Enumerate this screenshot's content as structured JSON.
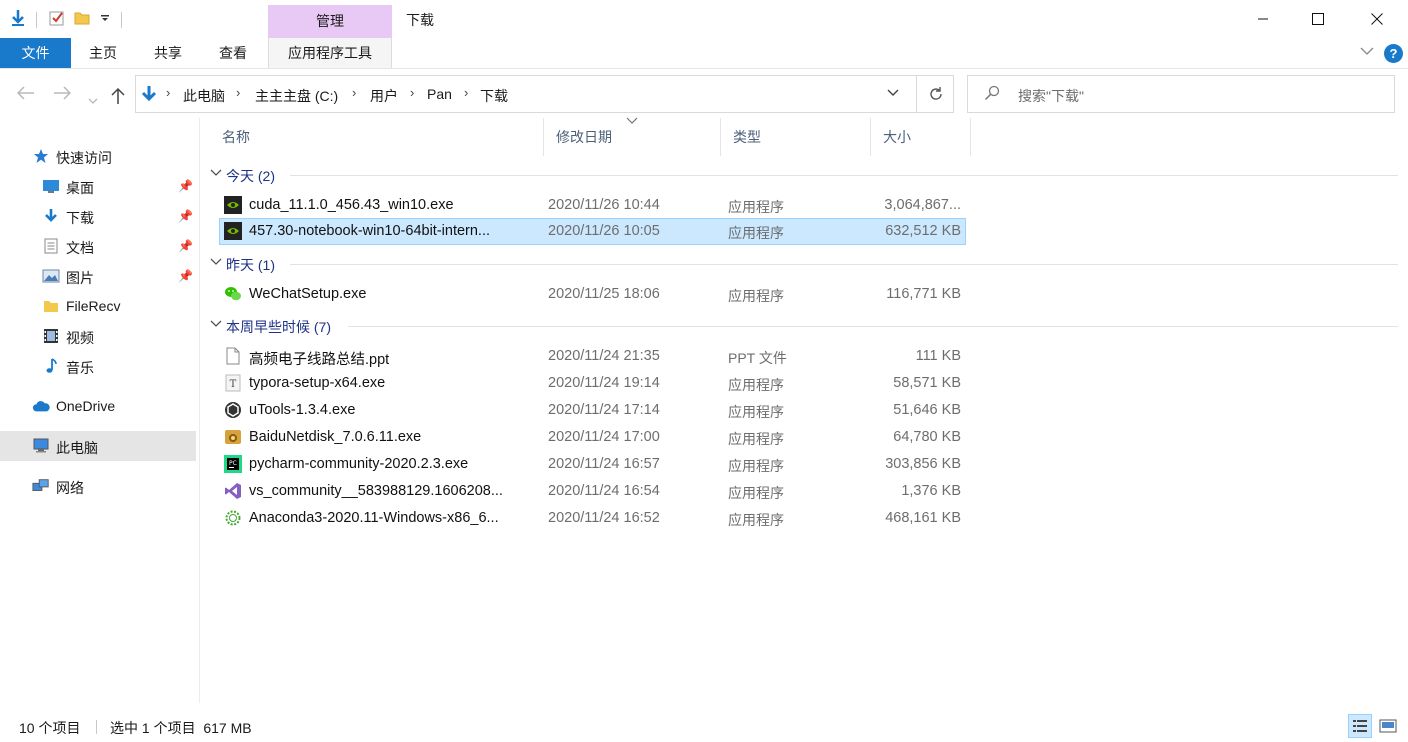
{
  "quick_access_toolbar": {
    "icons": [
      "properties-icon",
      "folder-icon",
      "customize-icon"
    ]
  },
  "ribbon": {
    "context_group": "管理",
    "window_title": "下载",
    "tabs": {
      "file": "文件",
      "home": "主页",
      "share": "共享",
      "view": "查看",
      "app_tools": "应用程序工具"
    },
    "help": "?"
  },
  "window_controls": {
    "minimize": "—",
    "maximize": "☐",
    "close": "✕"
  },
  "address_bar": {
    "path": [
      "此电脑",
      "主主主盘 (C:)",
      "用户",
      "Pan",
      "下载"
    ]
  },
  "search": {
    "placeholder": "搜索\"下载\""
  },
  "sidebar": {
    "items": [
      {
        "label": "快速访问",
        "icon": "star-icon"
      },
      {
        "label": "桌面",
        "icon": "desktop-icon",
        "pinned": true
      },
      {
        "label": "下载",
        "icon": "download-icon",
        "pinned": true
      },
      {
        "label": "文档",
        "icon": "document-icon",
        "pinned": true
      },
      {
        "label": "图片",
        "icon": "picture-icon",
        "pinned": true
      },
      {
        "label": "FileRecv",
        "icon": "folder-icon"
      },
      {
        "label": "视频",
        "icon": "video-icon"
      },
      {
        "label": "音乐",
        "icon": "music-icon"
      },
      {
        "label": "OneDrive",
        "icon": "cloud-icon"
      },
      {
        "label": "此电脑",
        "icon": "computer-icon",
        "selected": true
      },
      {
        "label": "网络",
        "icon": "network-icon"
      }
    ]
  },
  "columns": {
    "name": "名称",
    "modified": "修改日期",
    "type": "类型",
    "size": "大小"
  },
  "groups": [
    {
      "title": "今天 (2)"
    },
    {
      "title": "昨天 (1)"
    },
    {
      "title": "本周早些时候 (7)"
    }
  ],
  "files": [
    {
      "name": "cuda_11.1.0_456.43_win10.exe",
      "date": "2020/11/26 10:44",
      "type": "应用程序",
      "size": "3,064,867...",
      "icon": "nvidia-icon",
      "group": 0
    },
    {
      "name": "457.30-notebook-win10-64bit-intern...",
      "date": "2020/11/26 10:05",
      "type": "应用程序",
      "size": "632,512 KB",
      "icon": "nvidia-icon",
      "group": 0,
      "selected": true
    },
    {
      "name": "WeChatSetup.exe",
      "date": "2020/11/25 18:06",
      "type": "应用程序",
      "size": "116,771 KB",
      "icon": "wechat-icon",
      "group": 1
    },
    {
      "name": "高频电子线路总结.ppt",
      "date": "2020/11/24 21:35",
      "type": "PPT 文件",
      "size": "111 KB",
      "icon": "file-icon",
      "group": 2
    },
    {
      "name": "typora-setup-x64.exe",
      "date": "2020/11/24 19:14",
      "type": "应用程序",
      "size": "58,571 KB",
      "icon": "typora-icon",
      "group": 2
    },
    {
      "name": "uTools-1.3.4.exe",
      "date": "2020/11/24 17:14",
      "type": "应用程序",
      "size": "51,646 KB",
      "icon": "utools-icon",
      "group": 2
    },
    {
      "name": "BaiduNetdisk_7.0.6.11.exe",
      "date": "2020/11/24 17:00",
      "type": "应用程序",
      "size": "64,780 KB",
      "icon": "baidu-netdisk-icon",
      "group": 2
    },
    {
      "name": "pycharm-community-2020.2.3.exe",
      "date": "2020/11/24 16:57",
      "type": "应用程序",
      "size": "303,856 KB",
      "icon": "pycharm-icon",
      "group": 2
    },
    {
      "name": "vs_community__583988129.1606208...",
      "date": "2020/11/24 16:54",
      "type": "应用程序",
      "size": "1,376 KB",
      "icon": "visual-studio-icon",
      "group": 2
    },
    {
      "name": "Anaconda3-2020.11-Windows-x86_6...",
      "date": "2020/11/24 16:52",
      "type": "应用程序",
      "size": "468,161 KB",
      "icon": "anaconda-icon",
      "group": 2
    }
  ],
  "status": {
    "count": "10 个项目",
    "selection": "选中 1 个项目  617 MB"
  },
  "colors": {
    "accent": "#1979ca",
    "selected_row": "#cce8ff",
    "context_tab": "#e8c9f5",
    "group_title": "#1e3287"
  }
}
